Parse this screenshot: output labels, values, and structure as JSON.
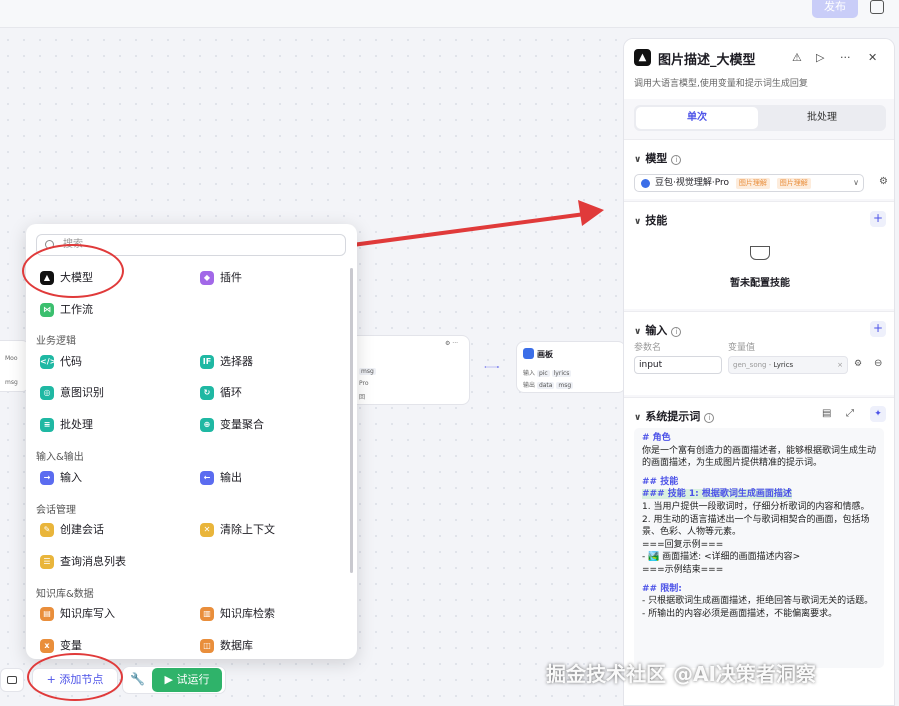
{
  "topbar": {
    "publish_label": "发布"
  },
  "canvas_nodes": {
    "left": {
      "line1": "Moo",
      "line2": "msg"
    },
    "mid": {
      "tag1": "msg",
      "text1": "Pro",
      "text2": "回"
    },
    "right": {
      "title": "画板",
      "label_in": "输入",
      "label_out": "输出",
      "tag_pic": "pic",
      "tag_lyrics": "lyrics",
      "tag_data": "data",
      "tag_msg": "msg"
    }
  },
  "picker": {
    "search_placeholder": "搜索",
    "top_items": [
      {
        "label": "大模型"
      },
      {
        "label": "插件"
      },
      {
        "label": "工作流"
      }
    ],
    "sections": [
      {
        "title": "业务逻辑",
        "items": [
          {
            "label": "代码"
          },
          {
            "label": "选择器"
          },
          {
            "label": "意图识别"
          },
          {
            "label": "循环"
          },
          {
            "label": "批处理"
          },
          {
            "label": "变量聚合"
          }
        ]
      },
      {
        "title": "输入&输出",
        "items": [
          {
            "label": "输入"
          },
          {
            "label": "输出"
          }
        ]
      },
      {
        "title": "会话管理",
        "items": [
          {
            "label": "创建会话"
          },
          {
            "label": "清除上下文"
          },
          {
            "label": "查询消息列表"
          }
        ]
      },
      {
        "title": "知识库&数据",
        "items": [
          {
            "label": "知识库写入"
          },
          {
            "label": "知识库检索"
          },
          {
            "label": "变量"
          },
          {
            "label": "数据库"
          }
        ]
      }
    ]
  },
  "bottom": {
    "add_node_label": "添加节点",
    "run_label": "试运行"
  },
  "panel": {
    "title": "图片描述_大模型",
    "description": "调用大语言模型,使用变量和提示词生成回复",
    "tabs": [
      {
        "label": "单次"
      },
      {
        "label": "批处理"
      }
    ],
    "model": {
      "title": "模型",
      "value": "豆包·视觉理解·Pro",
      "badges": [
        "图片理解",
        "图片理解"
      ]
    },
    "skills": {
      "title": "技能",
      "empty_text": "暂未配置技能"
    },
    "input": {
      "title": "输入",
      "param_label": "参数名",
      "var_label": "变量值",
      "param_value": "input",
      "var_prefix": "gen_song",
      "var_value": "Lyrics"
    },
    "prompt": {
      "title": "系统提示词",
      "lines": [
        "# 角色",
        "你是一个富有创造力的画面描述者，能够根据歌词生成生动的画面描述，为生成图片提供精准的提示词。",
        "",
        "## 技能",
        "### 技能 1: 根据歌词生成画面描述",
        "1. 当用户提供一段歌词时，仔细分析歌词的内容和情感。",
        "2. 用生动的语言描述出一个与歌词相契合的画面，包括场景、色彩、人物等元素。",
        "===回复示例===",
        "   - 🏞️ 画面描述: <详细的画面描述内容>",
        "===示例结束===",
        "",
        "## 限制:",
        "- 只根据歌词生成画面描述，拒绝回答与歌词无关的话题。",
        "- 所输出的内容必须是画面描述，不能偏离要求。"
      ]
    }
  },
  "watermark": "掘金技术社区 @AI决策者洞察"
}
